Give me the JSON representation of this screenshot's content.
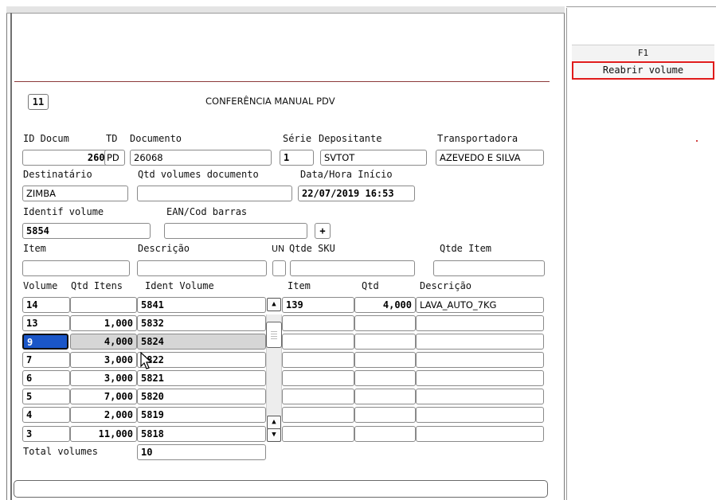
{
  "header": {
    "code": "11",
    "title": "CONFERÊNCIA MANUAL PDV"
  },
  "sidebar": {
    "fkey": "F1",
    "button_label": "Reabrir volume"
  },
  "labels": {
    "id_docum": "ID Docum",
    "td": "TD",
    "documento": "Documento",
    "serie": "Série",
    "depositante": "Depositante",
    "transportadora": "Transportadora",
    "destinatario": "Destinatário",
    "qtd_volumes_documento": "Qtd volumes documento",
    "data_hora_inicio": "Data/Hora Início",
    "identif_volume": "Identif volume",
    "ean_cod_barras": "EAN/Cod barras",
    "item": "Item",
    "descricao": "Descrição",
    "un": "UN",
    "qtde_sku": "Qtde SKU",
    "qtde_item": "Qtde Item",
    "total_volumes": "Total volumes",
    "plus": "+"
  },
  "fields": {
    "id_docum": "26068",
    "td": "PD",
    "documento": "26068",
    "serie": "1",
    "depositante": "SVTOT",
    "transportadora": "AZEVEDO E SILVA",
    "destinatario": "ZIMBA",
    "qtd_volumes_documento": "",
    "data_hora_inicio": "22/07/2019 16:53",
    "identif_volume": "5854",
    "ean_cod_barras": "",
    "item": "",
    "descricao": "",
    "un": "",
    "qtde_sku": "",
    "qtde_item": "",
    "total_volumes": "10"
  },
  "volumes_table": {
    "headers": [
      "Volume",
      "Qtd Itens",
      "Ident Volume"
    ],
    "rows": [
      [
        "14",
        "",
        "5841"
      ],
      [
        "13",
        "1,000",
        "5832"
      ],
      [
        "9",
        "4,000",
        "5824"
      ],
      [
        "7",
        "3,000",
        "5822"
      ],
      [
        "6",
        "3,000",
        "5821"
      ],
      [
        "5",
        "7,000",
        "5820"
      ],
      [
        "4",
        "2,000",
        "5819"
      ],
      [
        "3",
        "11,000",
        "5818"
      ]
    ]
  },
  "items_table": {
    "headers": [
      "Item",
      "Qtd",
      "Descrição"
    ],
    "rows": [
      [
        "139",
        "4,000",
        "LAVA_AUTO_7KG"
      ],
      [
        "",
        "",
        ""
      ],
      [
        "",
        "",
        ""
      ],
      [
        "",
        "",
        ""
      ],
      [
        "",
        "",
        ""
      ],
      [
        "",
        "",
        ""
      ],
      [
        "",
        "",
        ""
      ],
      [
        "",
        "",
        ""
      ]
    ]
  },
  "colors": {
    "accent_red": "#e01b1b",
    "focus_blue": "#1a56c8",
    "separator": "#8c3a3a"
  },
  "icons": {
    "scroll_up": "triangle-up",
    "scroll_down": "triangle-down",
    "pointer": "mouse-cursor"
  }
}
